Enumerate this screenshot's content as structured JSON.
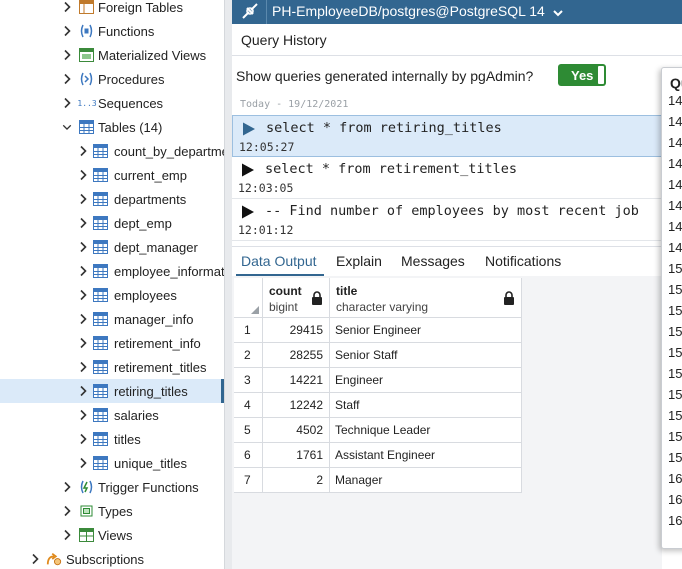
{
  "tree": {
    "items": [
      {
        "label": "Foreign Tables",
        "icon": "foreign-table-icon",
        "expanded": false
      },
      {
        "label": "Functions",
        "icon": "function-icon",
        "expanded": false
      },
      {
        "label": "Materialized Views",
        "icon": "materialized-view-icon",
        "expanded": false
      },
      {
        "label": "Procedures",
        "icon": "procedure-icon",
        "expanded": false
      },
      {
        "label": "Sequences",
        "icon": "sequence-icon",
        "icon_text": "1..3",
        "expanded": false
      },
      {
        "label": "Tables (14)",
        "icon": "tables-icon",
        "expanded": true
      },
      {
        "label": "count_by_departme",
        "icon": "table-icon",
        "expanded": false
      },
      {
        "label": "current_emp",
        "icon": "table-icon",
        "expanded": false
      },
      {
        "label": "departments",
        "icon": "table-icon",
        "expanded": false
      },
      {
        "label": "dept_emp",
        "icon": "table-icon",
        "expanded": false
      },
      {
        "label": "dept_manager",
        "icon": "table-icon",
        "expanded": false
      },
      {
        "label": "employee_informat",
        "icon": "table-icon",
        "expanded": false
      },
      {
        "label": "employees",
        "icon": "table-icon",
        "expanded": false
      },
      {
        "label": "manager_info",
        "icon": "table-icon",
        "expanded": false
      },
      {
        "label": "retirement_info",
        "icon": "table-icon",
        "expanded": false
      },
      {
        "label": "retirement_titles",
        "icon": "table-icon",
        "expanded": false
      },
      {
        "label": "retiring_titles",
        "icon": "table-icon",
        "expanded": false,
        "selected": true
      },
      {
        "label": "salaries",
        "icon": "table-icon",
        "expanded": false
      },
      {
        "label": "titles",
        "icon": "table-icon",
        "expanded": false
      },
      {
        "label": "unique_titles",
        "icon": "table-icon",
        "expanded": false
      },
      {
        "label": "Trigger Functions",
        "icon": "trigger-function-icon",
        "expanded": false
      },
      {
        "label": "Types",
        "icon": "type-icon",
        "expanded": false
      },
      {
        "label": "Views",
        "icon": "view-icon",
        "expanded": false
      },
      {
        "label": "Subscriptions",
        "icon": "subscription-icon",
        "expanded": false
      }
    ]
  },
  "header": {
    "title": "PH-EmployeeDB/postgres@PostgreSQL 14",
    "icon": "connection-icon",
    "dropdown_icon": "chevron-down-icon"
  },
  "query_history": {
    "title": "Query History",
    "show_internal_label": "Show queries generated internally by pgAdmin?",
    "toggle_label": "Yes",
    "toggle_on": true,
    "date_group": "Today - 19/12/2021",
    "entries": [
      {
        "query": "select * from retiring_titles",
        "time": "12:05:27",
        "selected": true
      },
      {
        "query": "select * from retirement_titles",
        "time": "12:03:05",
        "selected": false
      },
      {
        "query": "-- Find number of employees by most recent job",
        "time": "12:01:12",
        "selected": false
      }
    ]
  },
  "tabs": [
    {
      "label": "Data Output",
      "active": true
    },
    {
      "label": "Explain",
      "active": false
    },
    {
      "label": "Messages",
      "active": false
    },
    {
      "label": "Notifications",
      "active": false
    }
  ],
  "grid": {
    "columns": [
      {
        "name": "count",
        "type": "bigint"
      },
      {
        "name": "title",
        "type": "character varying"
      }
    ],
    "rows": [
      {
        "n": "1",
        "count": "29415",
        "title": "Senior Engineer"
      },
      {
        "n": "2",
        "count": "28255",
        "title": "Senior Staff"
      },
      {
        "n": "3",
        "count": "14221",
        "title": "Engineer"
      },
      {
        "n": "4",
        "count": "12242",
        "title": "Staff"
      },
      {
        "n": "5",
        "count": "4502",
        "title": "Technique Leader"
      },
      {
        "n": "6",
        "count": "1761",
        "title": "Assistant Engineer"
      },
      {
        "n": "7",
        "count": "2",
        "title": "Manager"
      }
    ]
  },
  "right_panel": {
    "header": "Qu",
    "lines": [
      "14",
      "14",
      "14",
      "14",
      "14",
      "14",
      "14",
      "14",
      "15",
      "15",
      "15",
      "15",
      "15",
      "15",
      "15",
      "15",
      "15",
      "15",
      "16",
      "16",
      "16"
    ]
  },
  "colors": {
    "header_bg": "#326690",
    "selection_bg": "#dbeaf9",
    "toggle_on": "#2e8b34",
    "play_icon": "#326690"
  }
}
